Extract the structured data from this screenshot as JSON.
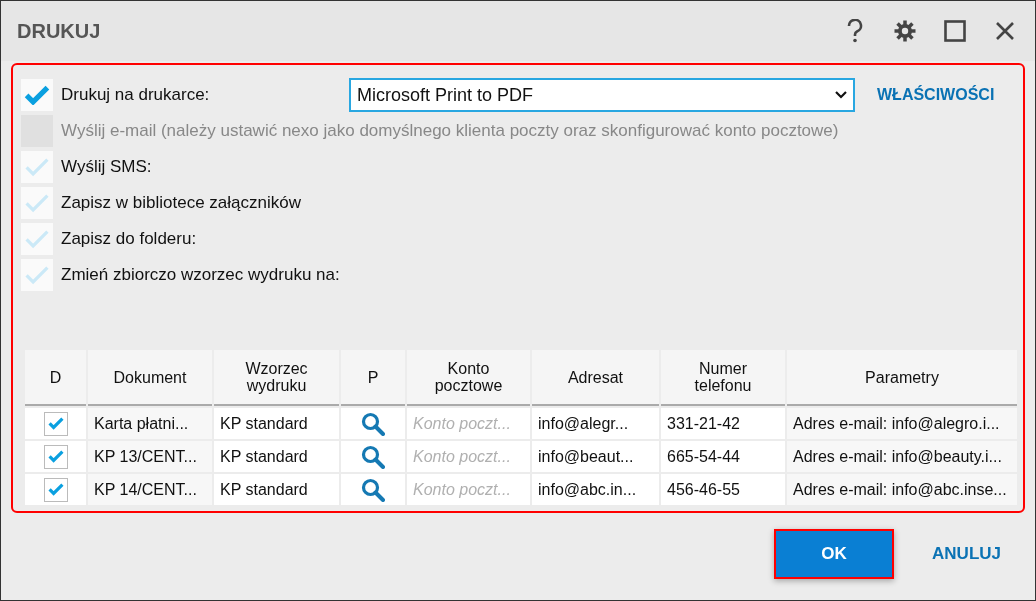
{
  "window": {
    "title": "DRUKUJ"
  },
  "options": [
    {
      "label": "Drukuj na drukarce:",
      "checked": true,
      "disabled": false
    },
    {
      "label": "Wyślij e-mail (należy ustawić nexo jako domyślnego klienta poczty oraz skonfigurować konto pocztowe)",
      "checked": false,
      "disabled": true
    },
    {
      "label": "Wyślij SMS:",
      "checked": false,
      "disabled": false
    },
    {
      "label": "Zapisz w bibliotece załączników",
      "checked": false,
      "disabled": false
    },
    {
      "label": "Zapisz do folderu:",
      "checked": false,
      "disabled": false
    },
    {
      "label": "Zmień zbiorczo wzorzec wydruku na:",
      "checked": false,
      "disabled": false
    }
  ],
  "printer": {
    "value": "Microsoft Print to PDF"
  },
  "properties_link": "WŁAŚCIWOŚCI",
  "table": {
    "columns": [
      "D",
      "Dokument",
      "Wzorzec wydruku",
      "P",
      "Konto pocztowe",
      "Adresat",
      "Numer telefonu",
      "Parametry"
    ],
    "rows": [
      {
        "checked": true,
        "document": "Karta płatni...",
        "template": "KP standard",
        "account_placeholder": "Konto poczt...",
        "recipient": "info@alegr...",
        "phone": "331-21-42",
        "parameters": "Adres e-mail: info@alegro.i..."
      },
      {
        "checked": true,
        "document": "KP 13/CENT...",
        "template": "KP standard",
        "account_placeholder": "Konto poczt...",
        "recipient": "info@beaut...",
        "phone": "665-54-44",
        "parameters": "Adres e-mail: info@beauty.i..."
      },
      {
        "checked": true,
        "document": "KP 14/CENT...",
        "template": "KP standard",
        "account_placeholder": "Konto poczt...",
        "recipient": "info@abc.in...",
        "phone": "456-46-55",
        "parameters": "Adres e-mail: info@abc.inse..."
      }
    ]
  },
  "buttons": [
    {
      "label": "OK",
      "kind": "primary"
    },
    {
      "label": "ANULUJ",
      "kind": "link"
    }
  ]
}
